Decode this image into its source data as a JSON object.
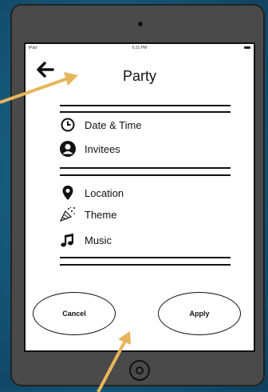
{
  "status_bar": {
    "device": "iPad",
    "time": "6:31 PM"
  },
  "header": {
    "title": "Party"
  },
  "menu_group_1": [
    {
      "label": "Date & Time",
      "icon": "clock-icon"
    },
    {
      "label": "Invitees",
      "icon": "user-icon"
    }
  ],
  "menu_group_2": [
    {
      "label": "Location",
      "icon": "location-pin-icon"
    },
    {
      "label": "Theme",
      "icon": "party-popper-icon"
    },
    {
      "label": "Music",
      "icon": "music-note-icon"
    }
  ],
  "buttons": {
    "cancel": "Cancel",
    "apply": "Apply"
  },
  "annotation_color": "#e8b55b"
}
